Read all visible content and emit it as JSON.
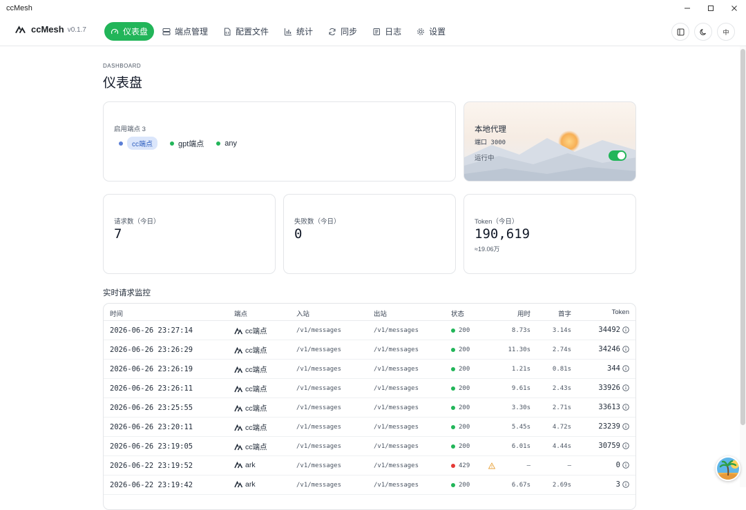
{
  "window": {
    "title": "ccMesh"
  },
  "brand": {
    "name": "ccMesh",
    "version": "v0.1.7"
  },
  "nav": {
    "items": [
      {
        "label": "仪表盘",
        "icon": "gauge-icon",
        "active": true
      },
      {
        "label": "端点管理",
        "icon": "server-icon",
        "active": false
      },
      {
        "label": "配置文件",
        "icon": "file-code-icon",
        "active": false
      },
      {
        "label": "统计",
        "icon": "bar-chart-icon",
        "active": false
      },
      {
        "label": "同步",
        "icon": "sync-icon",
        "active": false
      },
      {
        "label": "日志",
        "icon": "log-icon",
        "active": false
      },
      {
        "label": "设置",
        "icon": "gear-icon",
        "active": false
      }
    ],
    "lang_label": "中"
  },
  "page": {
    "eyebrow": "DASHBOARD",
    "title": "仪表盘"
  },
  "endpoints_card": {
    "label": "启用端点 3",
    "endpoints": [
      {
        "name": "cc端点",
        "color": "#5b7fd6",
        "highlighted": true
      },
      {
        "name": "gpt端点",
        "color": "#22b559",
        "highlighted": false
      },
      {
        "name": "any",
        "color": "#22b559",
        "highlighted": false
      }
    ]
  },
  "proxy_card": {
    "title": "本地代理",
    "port": "端口 3000",
    "status": "运行中",
    "enabled": true
  },
  "metrics": [
    {
      "label": "请求数（今日）",
      "value": "7",
      "sub": ""
    },
    {
      "label": "失败数（今日）",
      "value": "0",
      "sub": ""
    },
    {
      "label": "Token（今日）",
      "value": "190,619",
      "sub": "≈19.06万"
    }
  ],
  "monitor": {
    "title": "实时请求监控",
    "columns": [
      "时间",
      "端点",
      "入站",
      "出站",
      "状态",
      "用时",
      "首字",
      "Token"
    ],
    "rows": [
      {
        "time": "2026-06-26 23:27:14",
        "endpoint": "cc端点",
        "inbound": "/v1/messages",
        "outbound": "/v1/messages",
        "status": "200",
        "ok": true,
        "duration": "8.73s",
        "first": "3.14s",
        "token": "34492"
      },
      {
        "time": "2026-06-26 23:26:29",
        "endpoint": "cc端点",
        "inbound": "/v1/messages",
        "outbound": "/v1/messages",
        "status": "200",
        "ok": true,
        "duration": "11.30s",
        "first": "2.74s",
        "token": "34246"
      },
      {
        "time": "2026-06-26 23:26:19",
        "endpoint": "cc端点",
        "inbound": "/v1/messages",
        "outbound": "/v1/messages",
        "status": "200",
        "ok": true,
        "duration": "1.21s",
        "first": "0.81s",
        "token": "344"
      },
      {
        "time": "2026-06-26 23:26:11",
        "endpoint": "cc端点",
        "inbound": "/v1/messages",
        "outbound": "/v1/messages",
        "status": "200",
        "ok": true,
        "duration": "9.61s",
        "first": "2.43s",
        "token": "33926"
      },
      {
        "time": "2026-06-26 23:25:55",
        "endpoint": "cc端点",
        "inbound": "/v1/messages",
        "outbound": "/v1/messages",
        "status": "200",
        "ok": true,
        "duration": "3.30s",
        "first": "2.71s",
        "token": "33613"
      },
      {
        "time": "2026-06-26 23:20:11",
        "endpoint": "cc端点",
        "inbound": "/v1/messages",
        "outbound": "/v1/messages",
        "status": "200",
        "ok": true,
        "duration": "5.45s",
        "first": "4.72s",
        "token": "23239"
      },
      {
        "time": "2026-06-26 23:19:05",
        "endpoint": "cc端点",
        "inbound": "/v1/messages",
        "outbound": "/v1/messages",
        "status": "200",
        "ok": true,
        "duration": "6.01s",
        "first": "4.44s",
        "token": "30759"
      },
      {
        "time": "2026-06-22 23:19:52",
        "endpoint": "ark",
        "inbound": "/v1/messages",
        "outbound": "/v1/messages",
        "status": "429",
        "ok": false,
        "duration": "—",
        "first": "—",
        "token": "0"
      },
      {
        "time": "2026-06-22 23:19:42",
        "endpoint": "ark",
        "inbound": "/v1/messages",
        "outbound": "/v1/messages",
        "status": "200",
        "ok": true,
        "duration": "6.67s",
        "first": "2.69s",
        "token": "3"
      }
    ]
  },
  "colors": {
    "accent": "#22b559",
    "error": "#e53935",
    "warning": "#e8a33d",
    "endpoint_blue": "#5b7fd6"
  }
}
